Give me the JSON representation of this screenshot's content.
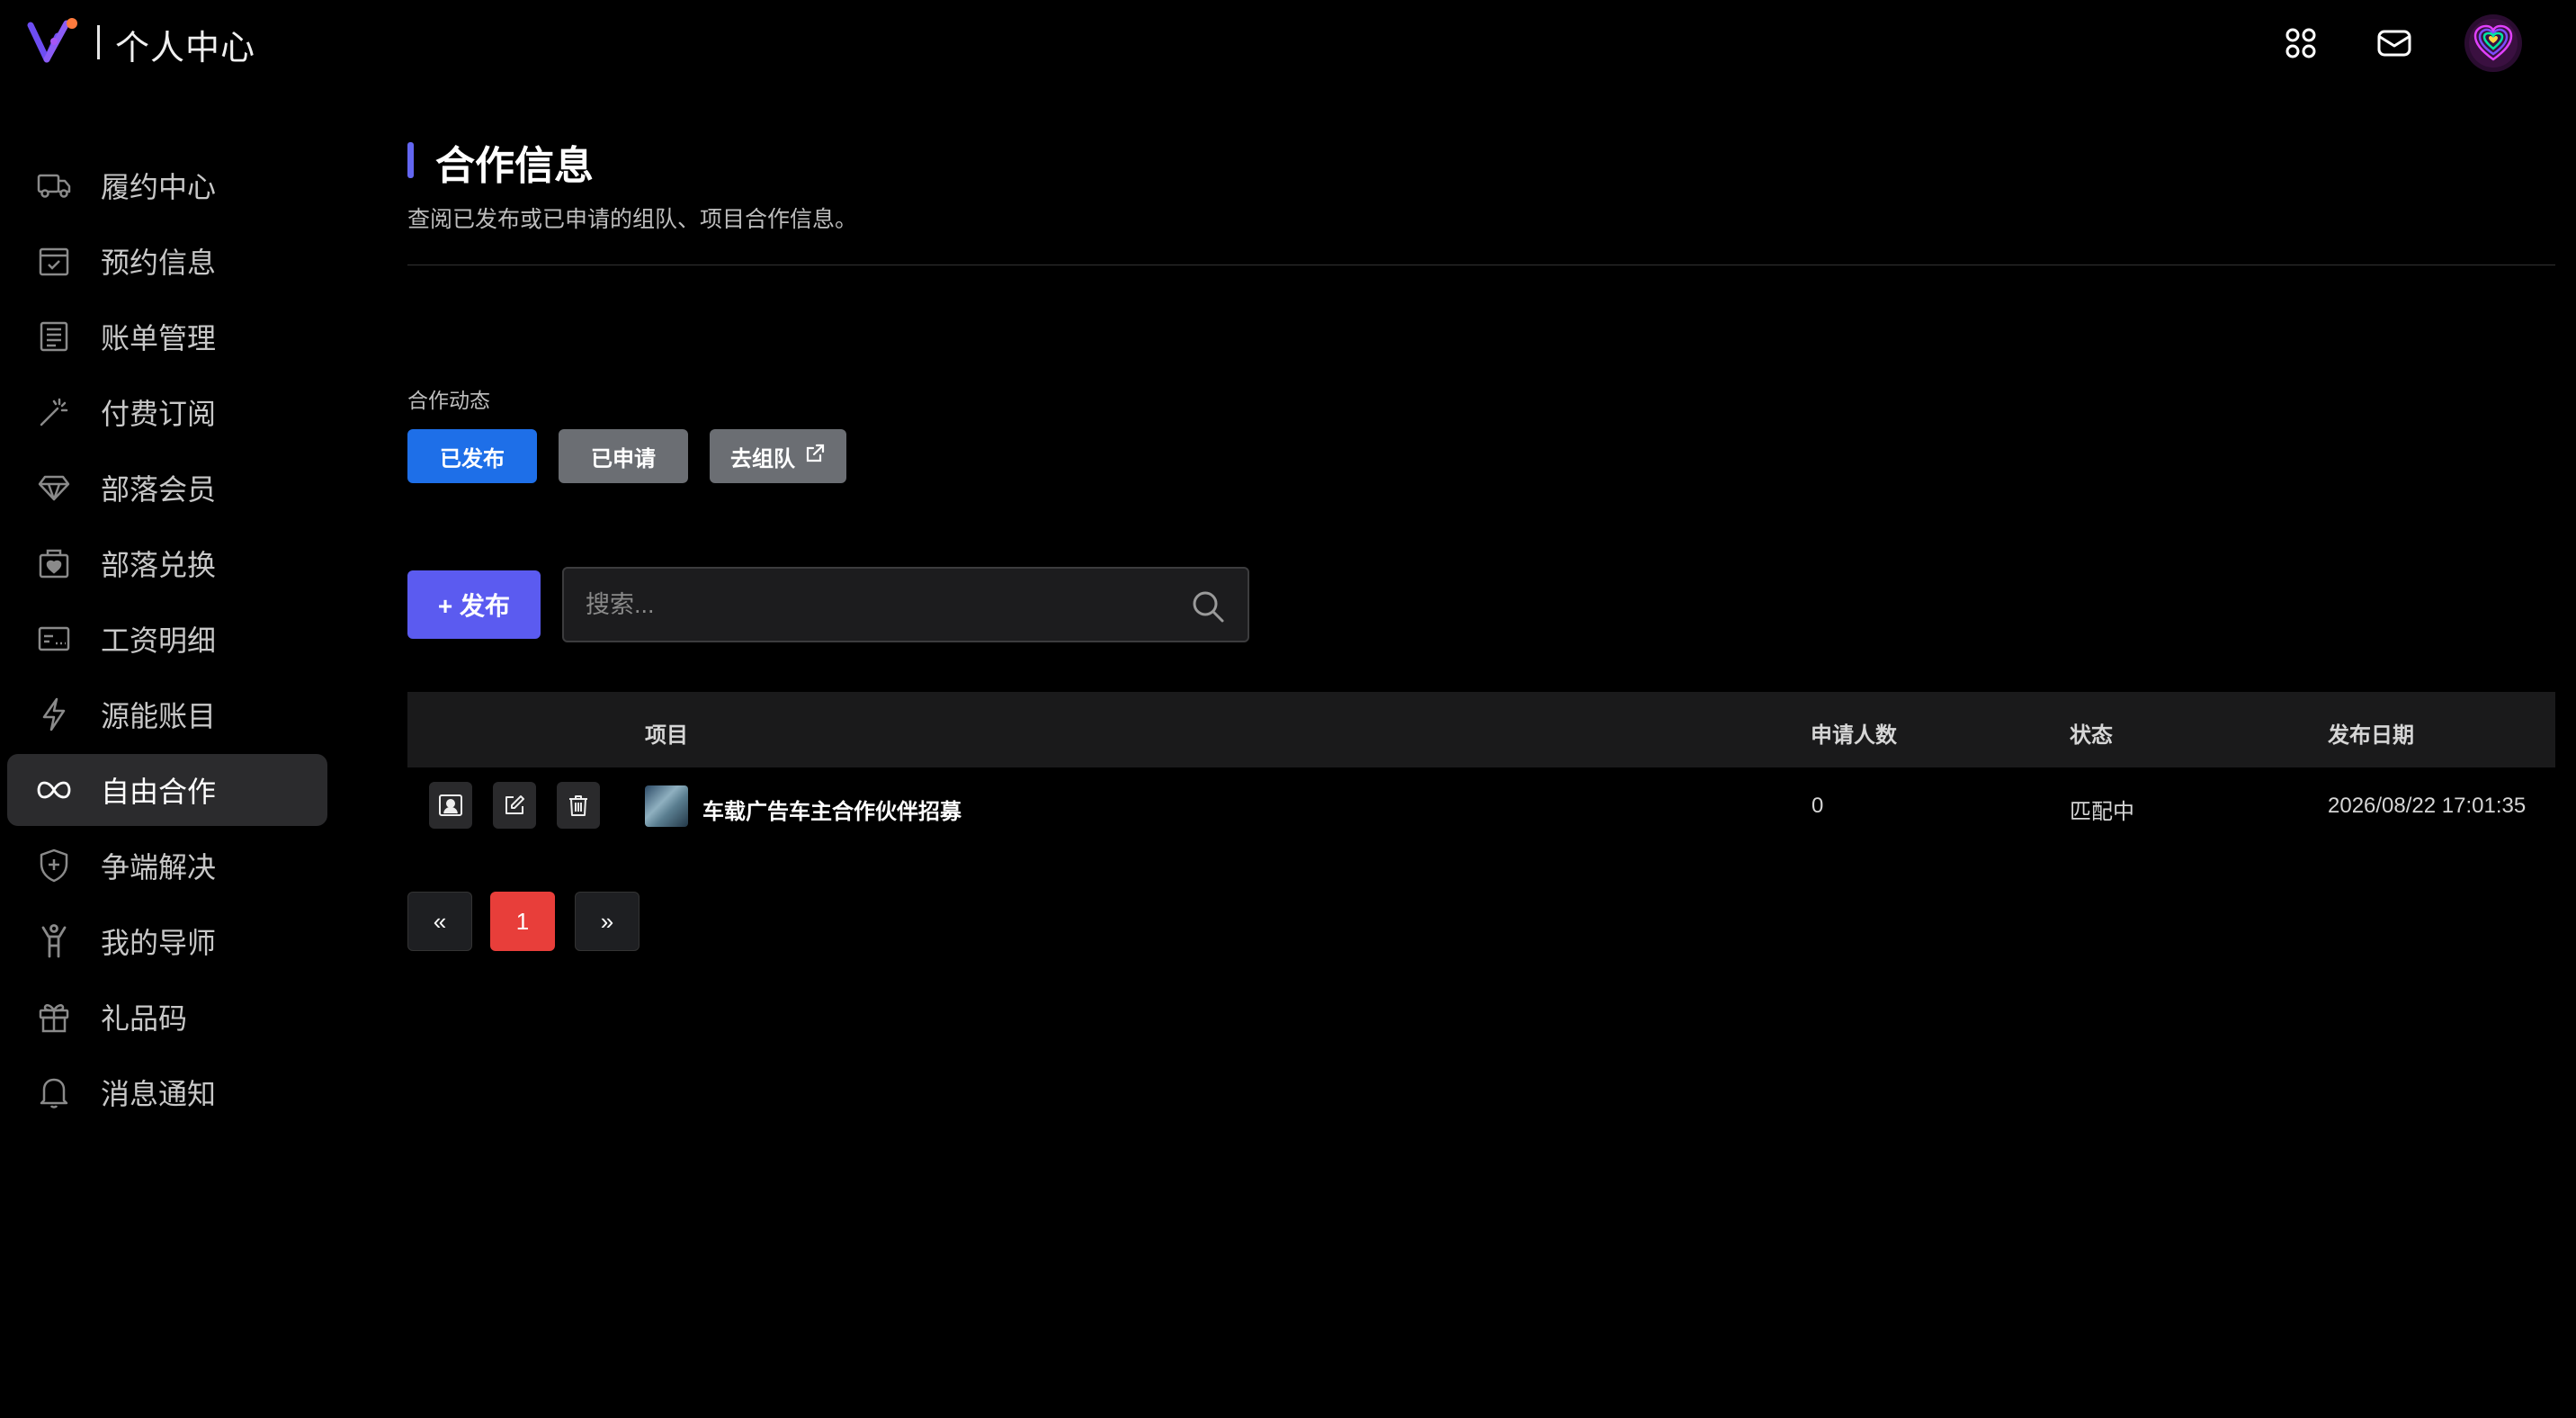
{
  "header": {
    "title": "个人中心",
    "icons": [
      "logo-icon",
      "apps-icon",
      "mail-icon",
      "avatar"
    ]
  },
  "sidebar": {
    "items": [
      {
        "label": "履约中心",
        "icon": "truck-icon"
      },
      {
        "label": "预约信息",
        "icon": "calendar-check-icon"
      },
      {
        "label": "账单管理",
        "icon": "receipt-icon"
      },
      {
        "label": "付费订阅",
        "icon": "magic-wand-icon"
      },
      {
        "label": "部落会员",
        "icon": "diamond-icon"
      },
      {
        "label": "部落兑换",
        "icon": "gift-box-heart-icon"
      },
      {
        "label": "工资明细",
        "icon": "payslip-card-icon"
      },
      {
        "label": "源能账目",
        "icon": "lightning-icon"
      },
      {
        "label": "自由合作",
        "icon": "infinity-icon",
        "active": true
      },
      {
        "label": "争端解决",
        "icon": "shield-plus-icon"
      },
      {
        "label": "我的导师",
        "icon": "person-raised-arms-icon"
      },
      {
        "label": "礼品码",
        "icon": "gift-icon"
      },
      {
        "label": "消息通知",
        "icon": "bell-icon"
      }
    ]
  },
  "main": {
    "title": "合作信息",
    "description": "查阅已发布或已申请的组队、项目合作信息。",
    "section_label": "合作动态",
    "tabs": {
      "published": "已发布",
      "applied": "已申请",
      "team": "去组队"
    },
    "publish_button": "+ 发布",
    "search": {
      "placeholder": "搜索...",
      "value": ""
    },
    "table": {
      "headers": {
        "project": "项目",
        "applicants": "申请人数",
        "status": "状态",
        "date": "发布日期"
      },
      "rows": [
        {
          "project": "车载广告车主合作伙伴招募",
          "applicants": "0",
          "status": "匹配中",
          "date": "2026/08/22 17:01:35"
        }
      ]
    },
    "pagination": {
      "prev": "«",
      "current": "1",
      "next": "»"
    }
  },
  "colors": {
    "accent": "#6366f1",
    "primary_tab": "#1e6fe8",
    "secondary_tab": "#6b6e73",
    "current_page": "#e83e3a",
    "background": "#000000"
  }
}
